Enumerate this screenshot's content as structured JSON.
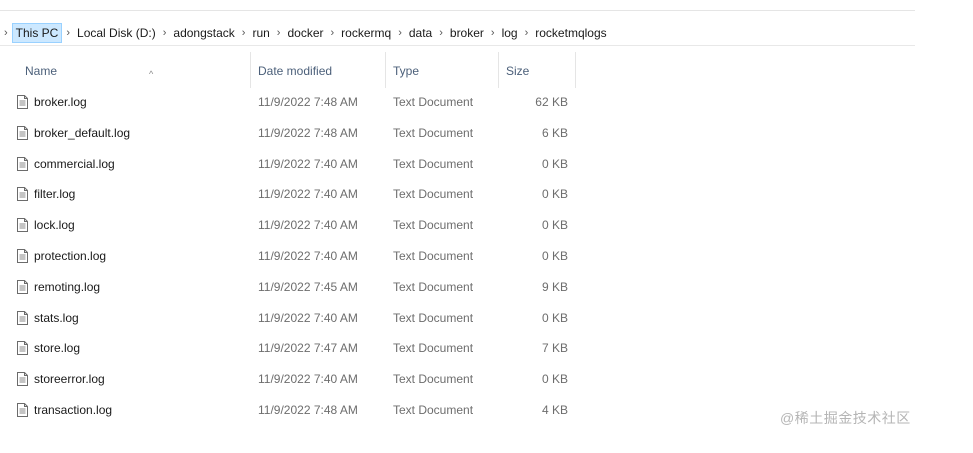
{
  "breadcrumb": {
    "items": [
      "This PC",
      "Local Disk (D:)",
      "adongstack",
      "run",
      "docker",
      "rockermq",
      "data",
      "broker",
      "log",
      "rocketmqlogs"
    ]
  },
  "columns": {
    "name": "Name",
    "date": "Date modified",
    "type": "Type",
    "size": "Size"
  },
  "files": [
    {
      "name": "broker.log",
      "date": "11/9/2022 7:48 AM",
      "type": "Text Document",
      "size": "62 KB"
    },
    {
      "name": "broker_default.log",
      "date": "11/9/2022 7:48 AM",
      "type": "Text Document",
      "size": "6 KB"
    },
    {
      "name": "commercial.log",
      "date": "11/9/2022 7:40 AM",
      "type": "Text Document",
      "size": "0 KB"
    },
    {
      "name": "filter.log",
      "date": "11/9/2022 7:40 AM",
      "type": "Text Document",
      "size": "0 KB"
    },
    {
      "name": "lock.log",
      "date": "11/9/2022 7:40 AM",
      "type": "Text Document",
      "size": "0 KB"
    },
    {
      "name": "protection.log",
      "date": "11/9/2022 7:40 AM",
      "type": "Text Document",
      "size": "0 KB"
    },
    {
      "name": "remoting.log",
      "date": "11/9/2022 7:45 AM",
      "type": "Text Document",
      "size": "9 KB"
    },
    {
      "name": "stats.log",
      "date": "11/9/2022 7:40 AM",
      "type": "Text Document",
      "size": "0 KB"
    },
    {
      "name": "store.log",
      "date": "11/9/2022 7:47 AM",
      "type": "Text Document",
      "size": "7 KB"
    },
    {
      "name": "storeerror.log",
      "date": "11/9/2022 7:40 AM",
      "type": "Text Document",
      "size": "0 KB"
    },
    {
      "name": "transaction.log",
      "date": "11/9/2022 7:48 AM",
      "type": "Text Document",
      "size": "4 KB"
    }
  ],
  "watermark": "@稀土掘金技术社区",
  "icons": {
    "file": "text-document-icon",
    "separator": "chevron-right-icon",
    "sort": "sort-ascending-icon"
  }
}
